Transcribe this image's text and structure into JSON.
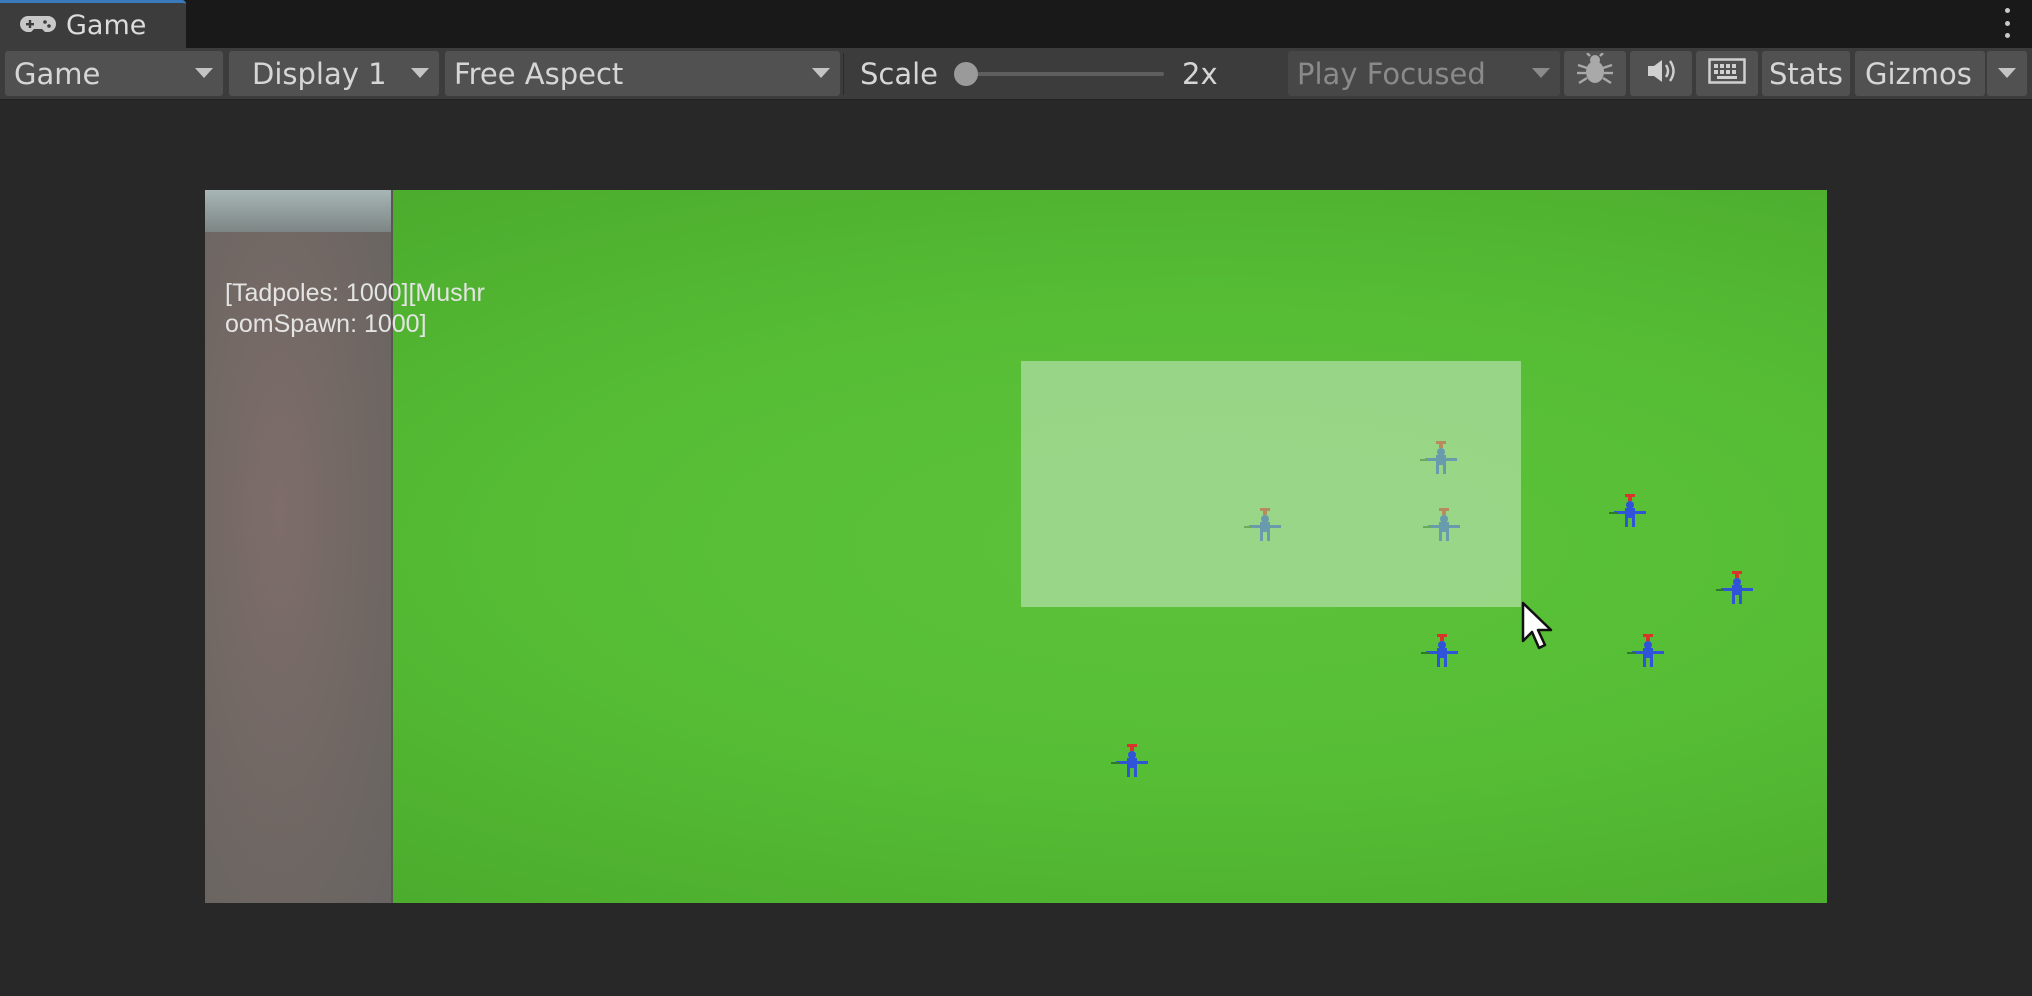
{
  "window": {
    "tab_title": "Game",
    "tab_icon": "gamepad-icon",
    "more_icon": "kebab-menu-icon"
  },
  "toolbar": {
    "view_dropdown": "Game",
    "display_dropdown": "Display 1",
    "aspect_dropdown": "Free Aspect",
    "scale_label": "Scale",
    "scale_value": "2x",
    "scale_fraction": 0.0,
    "play_mode_dropdown": "Play Focused",
    "debug_icon": "bug-icon",
    "audio_icon": "speaker-icon",
    "keyboard_icon": "keyboard-icon",
    "stats_label": "Stats",
    "gizmos_label": "Gizmos"
  },
  "game": {
    "hud_text": "[Tadpoles: 1000][MushroomSpawn: 1000]",
    "colors": {
      "ground": "#56be35",
      "unit_body": "#2f54d8",
      "unit_head": "#d9342b",
      "selection": "#cde8c8"
    }
  }
}
